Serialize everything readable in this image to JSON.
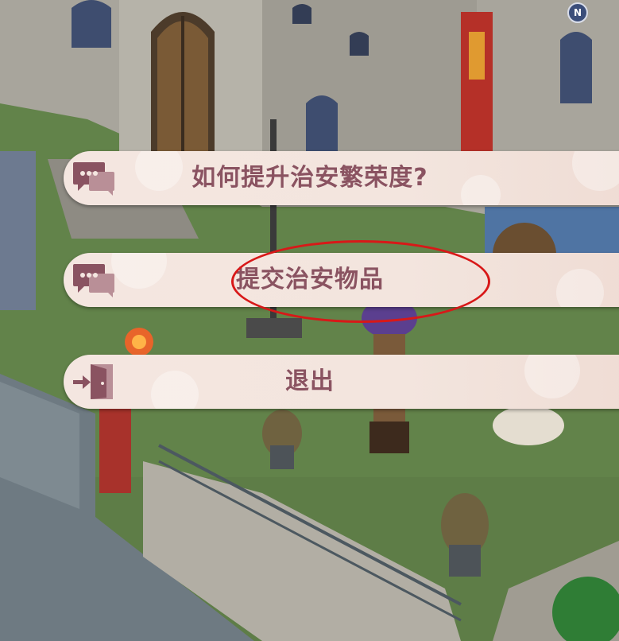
{
  "dialog": {
    "options": [
      {
        "label": "如何提升治安繁荣度?",
        "icon": "chat-bubble-icon"
      },
      {
        "label": "提交治安物品",
        "icon": "chat-bubble-icon"
      },
      {
        "label": "退出",
        "icon": "exit-door-icon"
      }
    ]
  },
  "hud": {
    "compass_label": "N"
  },
  "colors": {
    "option_bg": "#f4e6e0",
    "option_text": "#8a5361",
    "icon": "#8a5361",
    "highlight": "#d81818"
  }
}
